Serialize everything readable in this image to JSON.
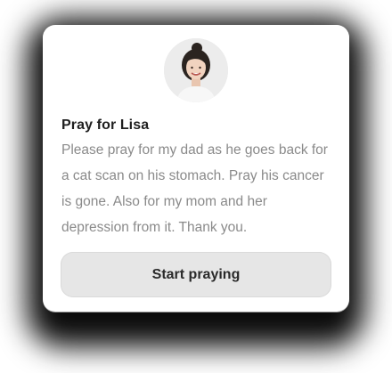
{
  "prayer_card": {
    "title": "Pray for Lisa",
    "message": "Please pray for my dad as he goes back for a cat scan on his stomach. Pray his cancer is gone. Also for my mom and her depression from it. Thank you.",
    "start_button_label": "Start praying",
    "avatar_icon": "user-avatar-photo"
  },
  "colors": {
    "card_background": "#ffffff",
    "title_text": "#1f1f1f",
    "body_text": "#8a8a8a",
    "button_background": "#e6e6e6"
  }
}
